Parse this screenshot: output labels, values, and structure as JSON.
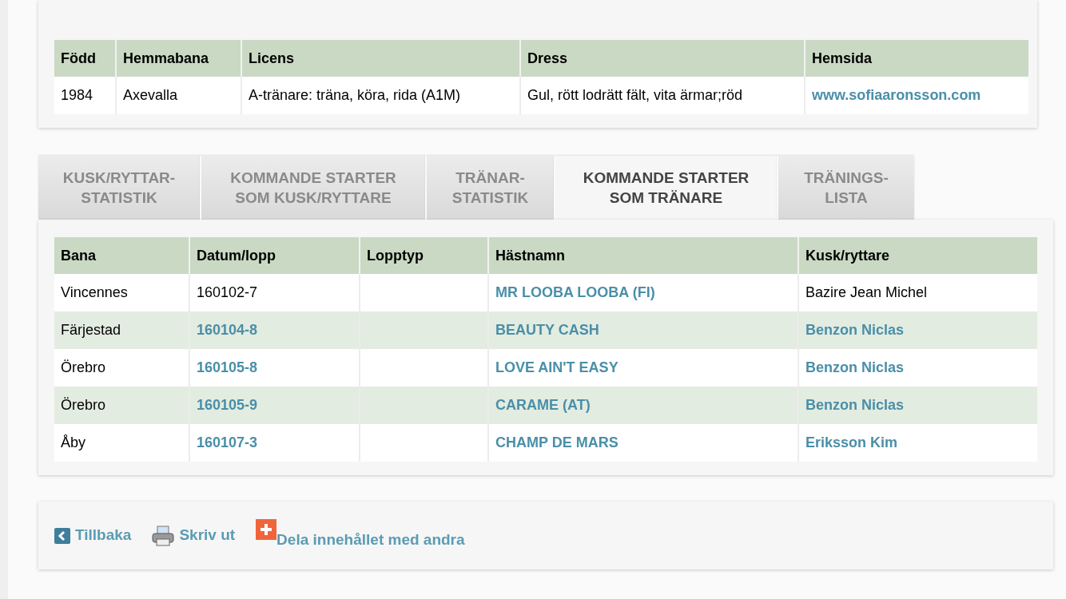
{
  "profile_table": {
    "columns": [
      "Född",
      "Hemmabana",
      "Licens",
      "Dress",
      "Hemsida"
    ],
    "rows": [
      [
        {
          "text": "1984",
          "link": false
        },
        {
          "text": "Axevalla",
          "link": false
        },
        {
          "text": "A-tränare: träna, köra, rida (A1M)",
          "link": false
        },
        {
          "text": "Gul, rött lodrätt fält, vita ärmar;röd",
          "link": false
        },
        {
          "text": "www.sofiaaronsson.com",
          "link": true
        }
      ]
    ]
  },
  "tabs": [
    {
      "label": "KUSK/RYTTAR-\nSTATISTIK",
      "selected": false
    },
    {
      "label": "KOMMANDE STARTER\nSOM KUSK/RYTTARE",
      "selected": false
    },
    {
      "label": "TRÄNAR-\nSTATISTIK",
      "selected": false
    },
    {
      "label": "KOMMANDE STARTER\nSOM TRÄNARE",
      "selected": true
    },
    {
      "label": "TRÄNINGS-\nLISTA",
      "selected": false
    }
  ],
  "starts_table": {
    "columns": [
      "Bana",
      "Datum/lopp",
      "Lopptyp",
      "Hästnamn",
      "Kusk/ryttare"
    ],
    "rows": [
      [
        {
          "text": "Vincennes",
          "link": false
        },
        {
          "text": "160102-7",
          "link": false
        },
        null,
        {
          "text": "MR LOOBA LOOBA (FI)",
          "link": true
        },
        {
          "text": "Bazire Jean Michel",
          "link": false
        }
      ],
      [
        {
          "text": "Färjestad",
          "link": false
        },
        {
          "text": "160104-8",
          "link": true
        },
        null,
        {
          "text": "BEAUTY CASH",
          "link": true
        },
        {
          "text": "Benzon Niclas",
          "link": true
        }
      ],
      [
        {
          "text": "Örebro",
          "link": false
        },
        {
          "text": "160105-8",
          "link": true
        },
        null,
        {
          "text": "LOVE AIN'T EASY",
          "link": true
        },
        {
          "text": "Benzon Niclas",
          "link": true
        }
      ],
      [
        {
          "text": "Örebro",
          "link": false
        },
        {
          "text": "160105-9",
          "link": true
        },
        null,
        {
          "text": "CARAME (AT)",
          "link": true
        },
        {
          "text": "Benzon Niclas",
          "link": true
        }
      ],
      [
        {
          "text": "Åby",
          "link": false
        },
        {
          "text": "160107-3",
          "link": true
        },
        null,
        {
          "text": "CHAMP DE MARS",
          "link": true
        },
        {
          "text": "Eriksson Kim",
          "link": true
        }
      ]
    ]
  },
  "footer_links": [
    {
      "kind": "back",
      "label": "Tillbaka"
    },
    {
      "kind": "print",
      "label": "Skriv ut"
    },
    {
      "kind": "share",
      "label": "Dela innehållet med andra"
    }
  ]
}
